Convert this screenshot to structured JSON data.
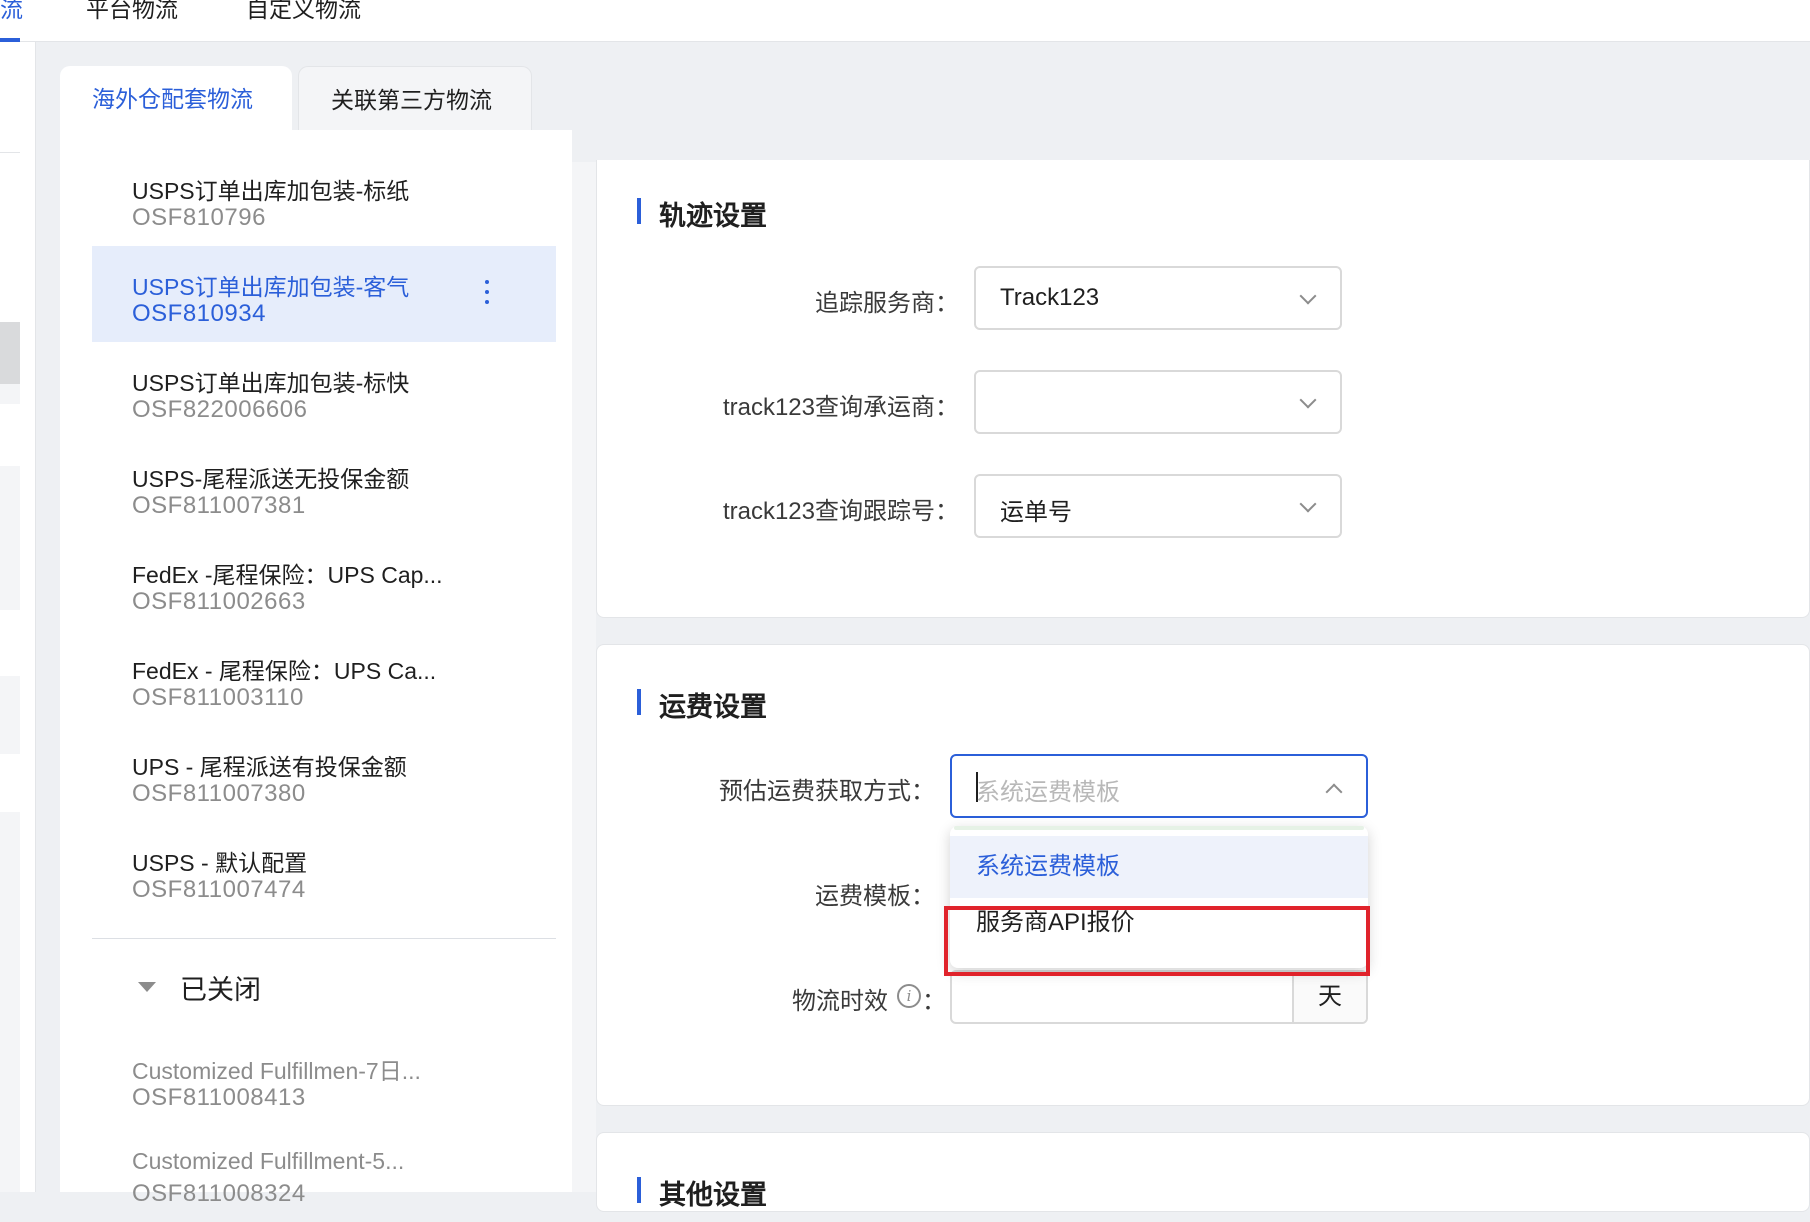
{
  "top_tabs": [
    {
      "label": "流",
      "active": true
    },
    {
      "label": "平台物流",
      "active": false
    },
    {
      "label": "自定义物流",
      "active": false
    }
  ],
  "sub_tabs": [
    {
      "label": "海外仓配套物流",
      "active": true
    },
    {
      "label": "关联第三方物流",
      "active": false
    }
  ],
  "logistics_list": [
    {
      "name": "USPS订单出库加包装-标纸",
      "code": "OSF810796"
    },
    {
      "name": "USPS订单出库加包装-客气",
      "code": "OSF810934",
      "selected": true
    },
    {
      "name": "USPS订单出库加包装-标快",
      "code": "OSF822006606"
    },
    {
      "name": "USPS-尾程派送无投保金额",
      "code": "OSF811007381"
    },
    {
      "name": "FedEx -尾程保险：UPS Cap...",
      "code": "OSF811002663"
    },
    {
      "name": "FedEx - 尾程保险：UPS Ca...",
      "code": "OSF811003110"
    },
    {
      "name": "UPS - 尾程派送有投保金额",
      "code": "OSF811007380"
    },
    {
      "name": "USPS - 默认配置",
      "code": "OSF811007474"
    }
  ],
  "closed_section": {
    "title": "已关闭",
    "items": [
      {
        "name": "Customized Fulfillmen-7日...",
        "code": "OSF811008413"
      },
      {
        "name": "Customized Fulfillment-5...",
        "code": "OSF811008324"
      }
    ]
  },
  "tracking": {
    "title": "轨迹设置",
    "provider_label": "追踪服务商：",
    "provider_value": "Track123",
    "carrier_label": "track123查询承运商：",
    "carrier_value": "",
    "number_label": "track123查询跟踪号：",
    "number_value": "运单号"
  },
  "freight": {
    "title": "运费设置",
    "method_label": "预估运费获取方式：",
    "method_placeholder": "系统运费模板",
    "template_label": "运费模板：",
    "timeliness_label": "物流时效",
    "timeliness_colon": "：",
    "timeliness_unit": "天",
    "dropdown_options": [
      "系统运费模板",
      "服务商API报价"
    ]
  },
  "other": {
    "title": "其他设置"
  },
  "colors": {
    "accent": "#2b5fd9",
    "highlight": "#e0232b"
  }
}
